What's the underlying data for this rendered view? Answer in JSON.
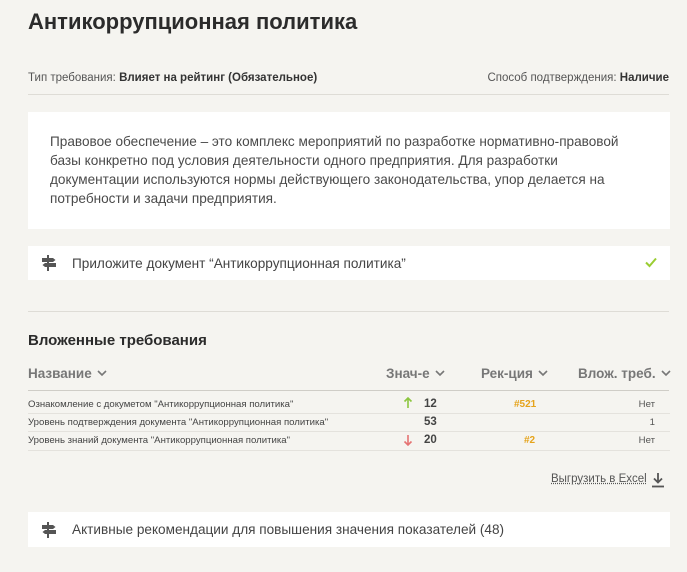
{
  "page_title": "Антикоррупционная политика",
  "meta": {
    "requirement_type_label": "Тип требования:",
    "requirement_type_value": "Влияет на рейтинг (Обязательное)",
    "confirmation_label": "Способ подтверждения:",
    "confirmation_value": "Наличие"
  },
  "description": "Правовое обеспечение – это комплекс мероприятий по разработке нормативно-правовой базы конкретно под условия деятельности одного предприятия. Для разработки документации используются нормы действующего законодательства, упор делается на потребности и задачи предприятия.",
  "attach_text": "Приложите документ “Антикоррупционная политика”",
  "nested": {
    "title": "Вложенные требования",
    "columns": [
      "Название",
      "Знач-е",
      "Рек-ция",
      "Влож. треб."
    ],
    "rows": [
      {
        "name": "Ознакомление с докуметом \"Антикоррупционная политика\"",
        "trend": "up",
        "value": "12",
        "rec": "#521",
        "nested": "Нет"
      },
      {
        "name": "Уровень подтверждения документа \"Антикоррупционная политика\"",
        "trend": "",
        "value": "53",
        "rec": "",
        "nested": "1"
      },
      {
        "name": "Уровень знаний документа \"Антикоррупционная политика\"",
        "trend": "down",
        "value": "20",
        "rec": "#2",
        "nested": "Нет"
      }
    ]
  },
  "export_label": "Выгрузить в Excel",
  "recs_text": "Активные рекомендации для повышения значения показателей (48)",
  "colors": {
    "accent": "#e5a31b",
    "up": "#8cc63f",
    "down": "#e57373",
    "check": "#9acd32"
  },
  "icons": {
    "attach": "signpost-icon",
    "check": "check-icon",
    "export": "download-icon",
    "sort": "chevron-down-icon"
  }
}
